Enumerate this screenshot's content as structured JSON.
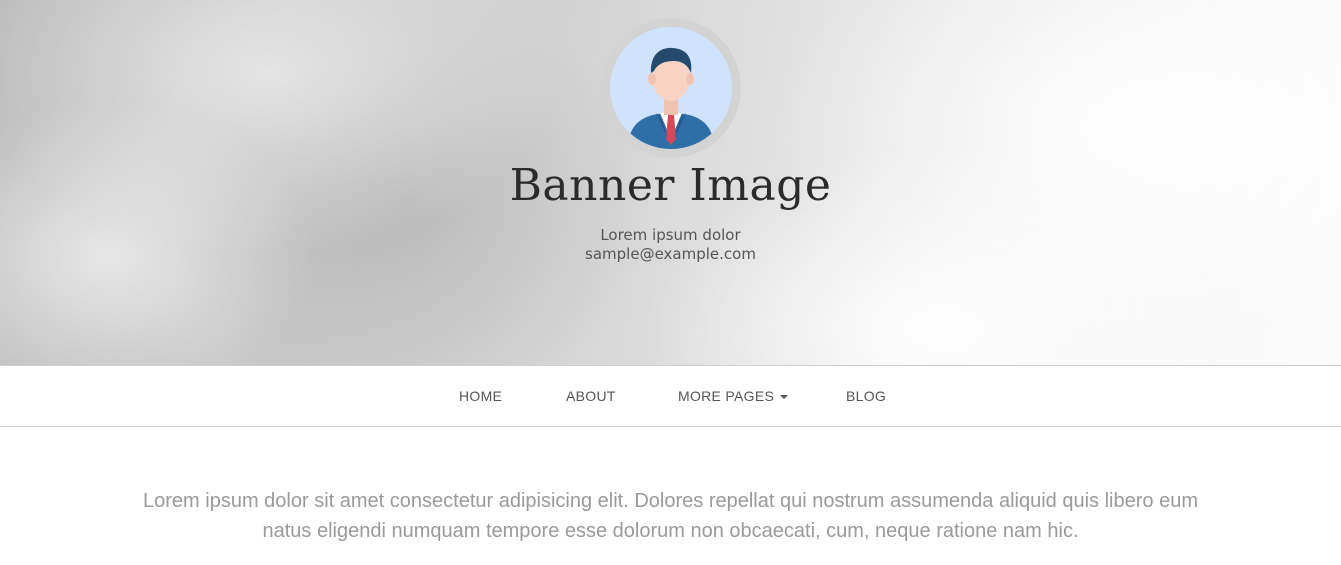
{
  "banner": {
    "title": "Banner Image",
    "subtitle": "Lorem ipsum dolor",
    "email": "sample@example.com",
    "avatar_icon": "user-avatar-icon"
  },
  "nav": {
    "items": [
      {
        "label": "HOME"
      },
      {
        "label": "ABOUT"
      },
      {
        "label": "MORE PAGES",
        "has_dropdown": true
      },
      {
        "label": "BLOG"
      }
    ]
  },
  "intro": {
    "text": "Lorem ipsum dolor sit amet consectetur adipisicing elit. Dolores repellat qui nostrum assumenda aliquid quis libero eum natus eligendi numquam tempore esse dolorum non obcaecati, cum, neque ratione nam hic."
  },
  "colors": {
    "title": "#2b2b2b",
    "nav_text": "#555555",
    "intro_text": "#9a9a9a",
    "avatar_bg": "#cfe3ff",
    "suit": "#2f6fa8",
    "tie": "#d6485a"
  }
}
